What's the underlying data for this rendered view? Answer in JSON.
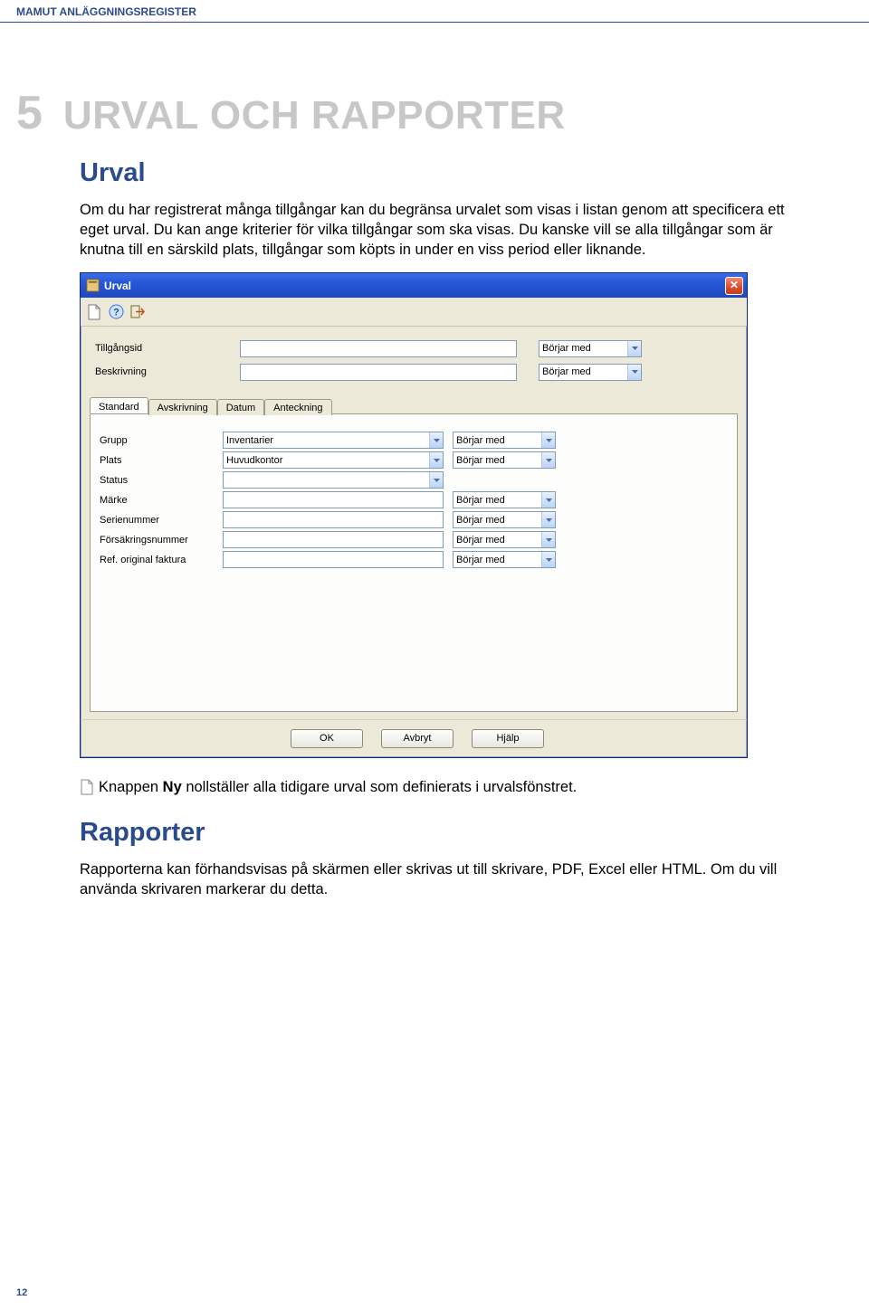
{
  "header": "MAMUT ANLÄGGNINGSREGISTER",
  "chapter": {
    "num": "5",
    "title": "URVAL OCH RAPPORTER"
  },
  "section_urval": {
    "heading": "Urval",
    "para": "Om du har registrerat många tillgångar kan du begränsa urvalet som visas i listan genom att specificera ett eget urval. Du kan ange kriterier för vilka tillgångar som ska visas. Du kanske vill se alla tillgångar som är knutna till en särskild plats, tillgångar som köpts in under en viss period eller liknande."
  },
  "window": {
    "title": "Urval",
    "filters": {
      "id_label": "Tillgångsid",
      "desc_label": "Beskrivning",
      "op": "Börjar med"
    },
    "tabs": [
      "Standard",
      "Avskrivning",
      "Datum",
      "Anteckning"
    ],
    "std": {
      "rows": [
        {
          "label": "Grupp",
          "value": "Inventarier",
          "op": "Börjar med",
          "dd": true
        },
        {
          "label": "Plats",
          "value": "Huvudkontor",
          "op": "Börjar med",
          "dd": true
        },
        {
          "label": "Status",
          "value": "",
          "op": "",
          "dd": true
        },
        {
          "label": "Märke",
          "value": "",
          "op": "Börjar med",
          "dd": false
        },
        {
          "label": "Serienummer",
          "value": "",
          "op": "Börjar med",
          "dd": false
        },
        {
          "label": "Försäkringsnummer",
          "value": "",
          "op": "Börjar med",
          "dd": false
        },
        {
          "label": "Ref. original faktura",
          "value": "",
          "op": "Börjar med",
          "dd": false
        }
      ]
    },
    "buttons": {
      "ok": "OK",
      "cancel": "Avbryt",
      "help": "Hjälp"
    }
  },
  "note": {
    "pre": "Knappen ",
    "bold": "Ny",
    "post": " nollställer alla tidigare urval som definierats i urvalsfönstret."
  },
  "section_rapporter": {
    "heading": "Rapporter",
    "para": "Rapporterna kan förhandsvisas på skärmen eller skrivas ut till skrivare, PDF, Excel eller HTML. Om du vill använda skrivaren markerar du detta."
  },
  "page_number": "12"
}
